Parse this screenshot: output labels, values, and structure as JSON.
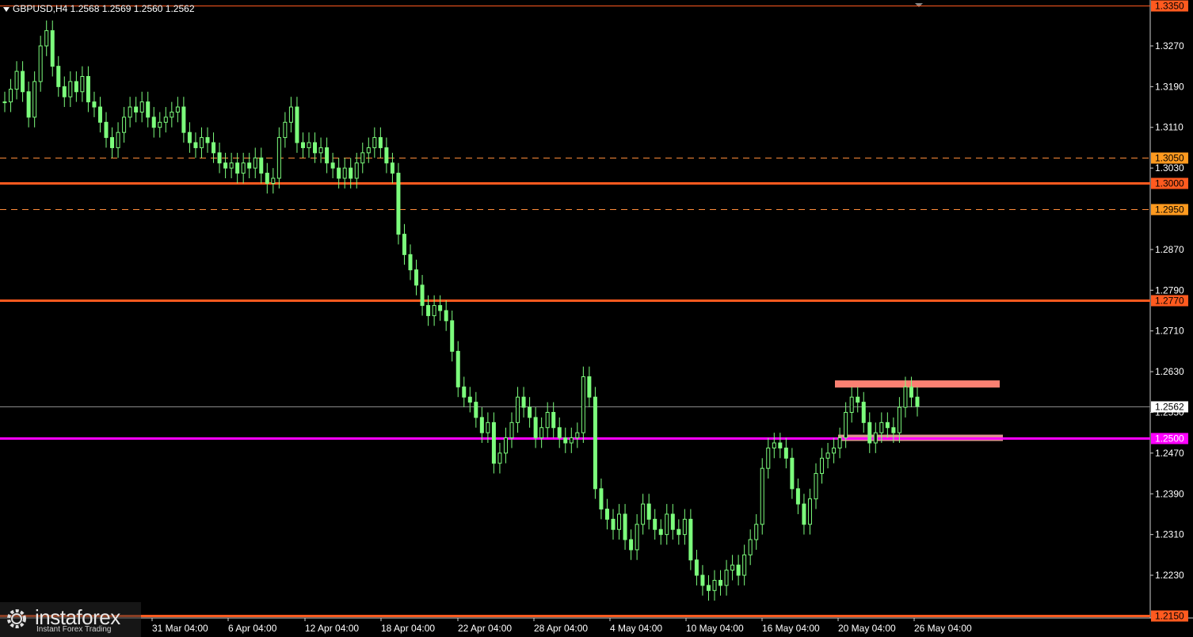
{
  "header": {
    "symbol_text": "GBPUSD,H4  1.2568 1.2569 1.2560 1.2562"
  },
  "logo": {
    "brand": "instaforex",
    "tagline": "Instant Forex Trading"
  },
  "colors": {
    "background": "#000000",
    "candle": "#7CFC7C",
    "level_orange": "#FF5A1F",
    "level_dashed": "#FF8C3A",
    "level_magenta": "#FF00FF",
    "zone_salmon": "#FA8072",
    "price_line": "#8A8A8A"
  },
  "chart_data": {
    "type": "line",
    "title": "GBPUSD,H4",
    "ylim": [
      2.2146,
      2.3354
    ],
    "ylim_note": "",
    "y_range": [
      1.2146,
      1.3354
    ],
    "y_ticks": [
      "1.3270",
      "1.3190",
      "1.3110",
      "1.3030",
      "1.2870",
      "1.2790",
      "1.2710",
      "1.2630",
      "1.2550",
      "1.2470",
      "1.2390",
      "1.2310",
      "1.2230"
    ],
    "x_ticks": [
      "31 Mar 04:00",
      "6 Apr 04:00",
      "12 Apr 04:00",
      "18 Apr 04:00",
      "22 Apr 04:00",
      "28 Apr 04:00",
      "4 May 04:00",
      "10 May 04:00",
      "16 May 04:00",
      "20 May 04:00",
      "26 May 04:00"
    ],
    "series": [
      {
        "values": [
          1.316,
          1.3185,
          1.322,
          1.318,
          1.313,
          1.32,
          1.327,
          1.33,
          1.323,
          1.319,
          1.317,
          1.32,
          1.318,
          1.321,
          1.316,
          1.315,
          1.312,
          1.309,
          1.307,
          1.31,
          1.313,
          1.315,
          1.314,
          1.316,
          1.313,
          1.311,
          1.312,
          1.313,
          1.314,
          1.315,
          1.31,
          1.308,
          1.307,
          1.309,
          1.308,
          1.306,
          1.304,
          1.303,
          1.304,
          1.302,
          1.304,
          1.303,
          1.305,
          1.302,
          1.3,
          1.301,
          1.309,
          1.312,
          1.315,
          1.308,
          1.307,
          1.308,
          1.306,
          1.307,
          1.304,
          1.303,
          1.301,
          1.303,
          1.301,
          1.304,
          1.306,
          1.307,
          1.309,
          1.307,
          1.304,
          1.302,
          1.29,
          1.286,
          1.283,
          1.28,
          1.276,
          1.274,
          1.276,
          1.275,
          1.273,
          1.267,
          1.26,
          1.258,
          1.257,
          1.254,
          1.251,
          1.253,
          1.245,
          1.247,
          1.25,
          1.253,
          1.258,
          1.256,
          1.254,
          1.25,
          1.252,
          1.255,
          1.252,
          1.25,
          1.249,
          1.25,
          1.251,
          1.262,
          1.258,
          1.24,
          1.236,
          1.234,
          1.232,
          1.235,
          1.23,
          1.228,
          1.233,
          1.237,
          1.234,
          1.232,
          1.231,
          1.235,
          1.232,
          1.231,
          1.234,
          1.226,
          1.223,
          1.221,
          1.22,
          1.222,
          1.221,
          1.224,
          1.225,
          1.223,
          1.227,
          1.23,
          1.233,
          1.244,
          1.248,
          1.249,
          1.248,
          1.246,
          1.24,
          1.237,
          1.233,
          1.238,
          1.243,
          1.246,
          1.247,
          1.248,
          1.25,
          1.255,
          1.258,
          1.257,
          1.253,
          1.249,
          1.251,
          1.253,
          1.252,
          1.251,
          1.256,
          1.26,
          1.258,
          1.2562
        ]
      }
    ],
    "levels": [
      {
        "price": 1.335,
        "label": "1.3350",
        "style": "solid-thin"
      },
      {
        "price": 1.305,
        "label": "1.3050",
        "style": "dashed"
      },
      {
        "price": 1.3,
        "label": "1.3000",
        "style": "solid"
      },
      {
        "price": 1.295,
        "label": "1.2950",
        "style": "dashed"
      },
      {
        "price": 1.277,
        "label": "1.2770",
        "style": "solid"
      },
      {
        "price": 1.25,
        "label": "1.2500",
        "style": "magenta"
      },
      {
        "price": 1.215,
        "label": "1.2150",
        "style": "solid"
      }
    ],
    "current_price": {
      "price": 1.2562,
      "label": "1.2562"
    },
    "zones": [
      {
        "price": 1.2605
      },
      {
        "price": 1.25
      }
    ]
  }
}
